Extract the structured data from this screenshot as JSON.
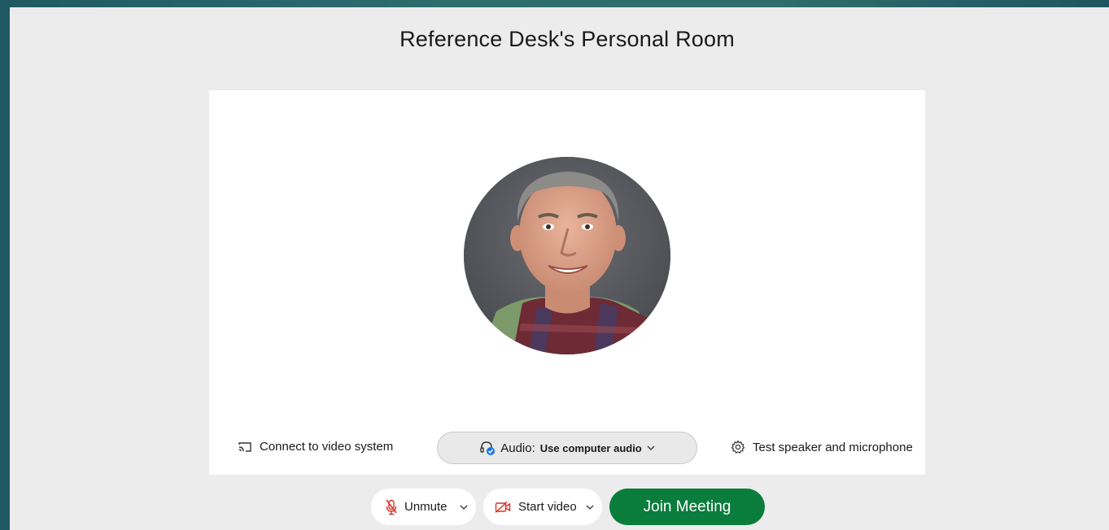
{
  "room": {
    "title": "Reference Desk's Personal Room"
  },
  "preview": {
    "connect_video_label": "Connect to video system",
    "audio_label": "Audio:",
    "audio_value": "Use computer audio",
    "test_speaker_label": "Test speaker and microphone"
  },
  "controls": {
    "unmute_label": "Unmute",
    "start_video_label": "Start video",
    "join_label": "Join Meeting"
  },
  "colors": {
    "join_green": "#0a7d3c",
    "muted_red": "#d93025",
    "audio_check_blue": "#1a73e8"
  }
}
